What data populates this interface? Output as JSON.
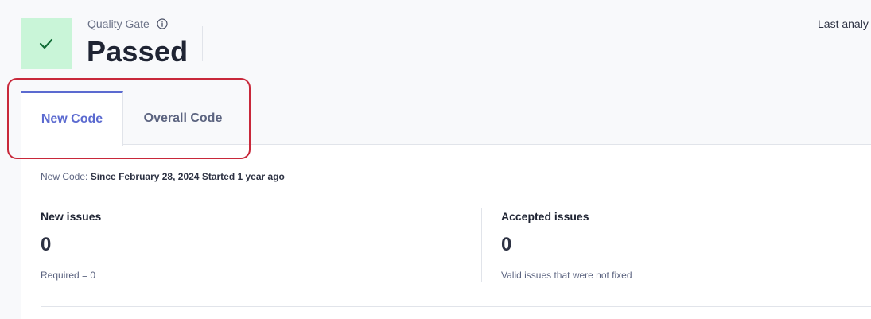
{
  "quality_gate": {
    "label": "Quality Gate",
    "status": "Passed",
    "status_color": "#c9f5d8",
    "icon": "check-icon",
    "info_icon": "info-icon"
  },
  "last_analysis": "Last analy",
  "tabs": [
    {
      "label": "New Code",
      "active": true
    },
    {
      "label": "Overall Code",
      "active": false
    }
  ],
  "new_code_period": {
    "prefix": "New Code:",
    "since": "Since February 28, 2024",
    "started": "Started 1 year ago"
  },
  "metrics": [
    {
      "title": "New issues",
      "value": "0",
      "subtitle": "Required = 0"
    },
    {
      "title": "Accepted issues",
      "value": "0",
      "subtitle": "Valid issues that were not fixed"
    }
  ],
  "colors": {
    "accent": "#5b6ad0",
    "highlight": "#c8283a",
    "passed_bg": "#c9f5d8",
    "passed_check": "#0f6b35"
  }
}
